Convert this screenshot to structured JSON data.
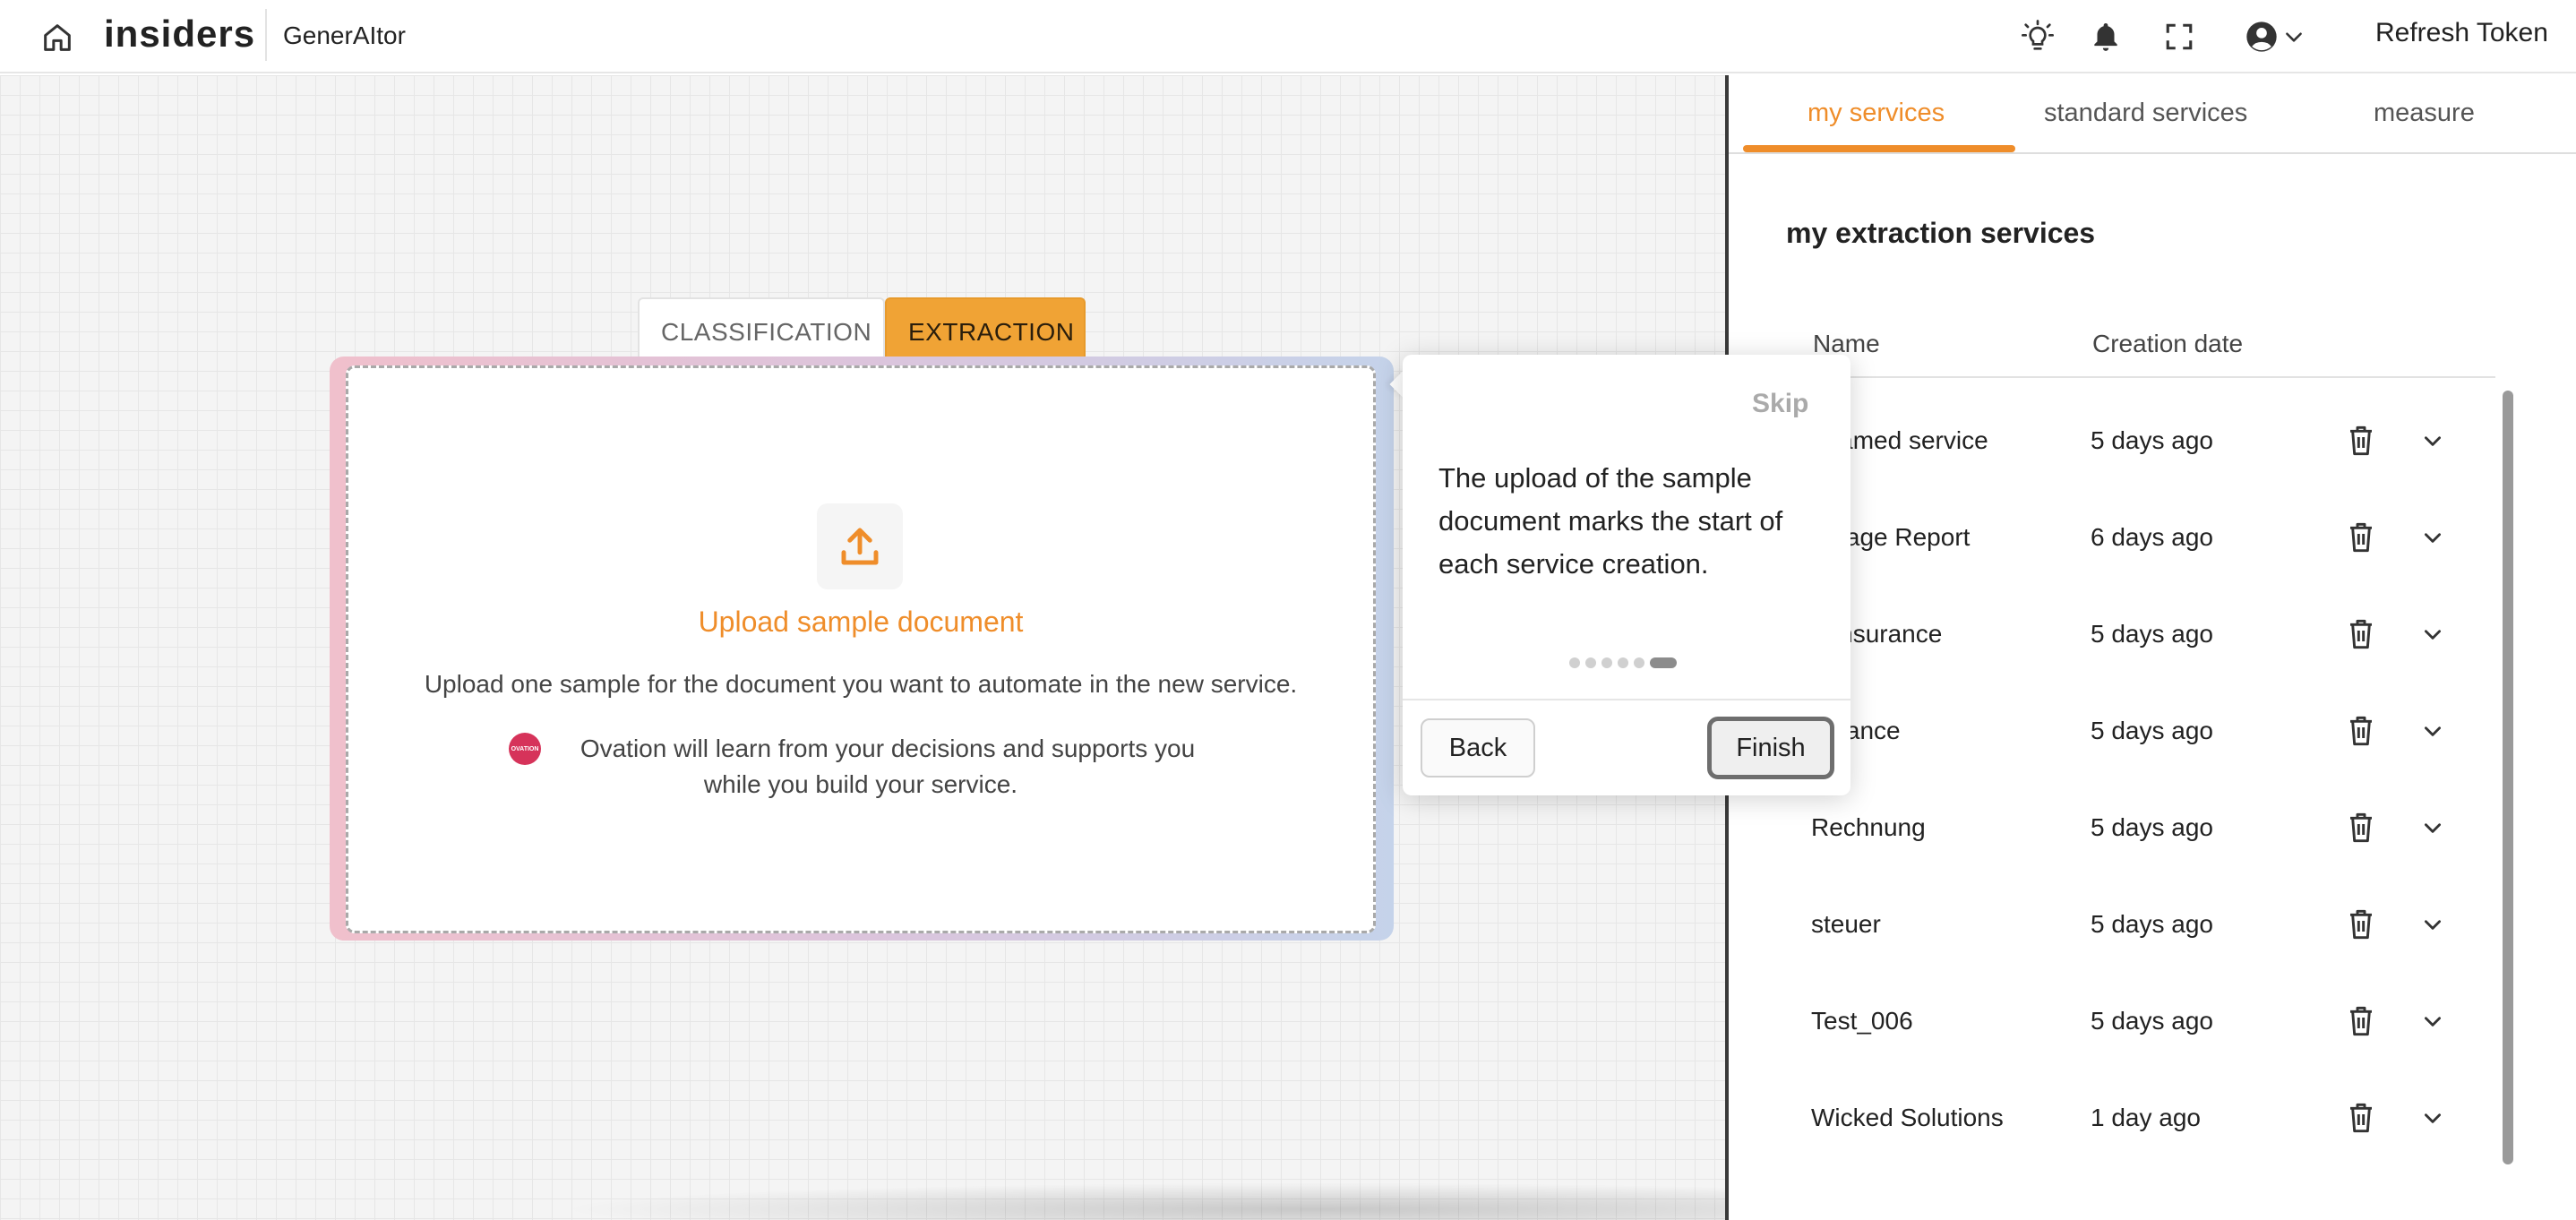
{
  "header": {
    "brand": "insiders",
    "app_name": "GenerAItor",
    "refresh_label": "Refresh Token",
    "icons": [
      "home-icon",
      "lightbulb-icon",
      "bell-icon",
      "fullscreen-icon",
      "user-circle-icon",
      "chevron-down-icon"
    ]
  },
  "mode_tabs": {
    "classification": "CLASSIFICATION",
    "extraction": "EXTRACTION",
    "active": "EXTRACTION"
  },
  "upload": {
    "title": "Upload sample document",
    "description": "Upload one sample for the document you want to automate in the new service.",
    "ovation_line1": "Ovation will learn from your decisions and supports you",
    "ovation_line2": "while you build your service.",
    "logo_text": "OVATION"
  },
  "tour": {
    "skip_label": "Skip",
    "text": "The upload of the sample document marks the start of each service creation.",
    "back_label": "Back",
    "finish_label": "Finish",
    "step_current": 6,
    "step_total": 6
  },
  "panel": {
    "tabs": [
      "my services",
      "standard services",
      "measure"
    ],
    "active_tab": "my services",
    "title": "my extraction services",
    "columns": {
      "name": "Name",
      "date": "Creation date"
    },
    "rows": [
      {
        "name": "nnamed service",
        "date": "5 days ago"
      },
      {
        "name": "amage Report",
        "date": "6 days ago"
      },
      {
        "name": "o Insurance",
        "date": "5 days ago"
      },
      {
        "name": "surance",
        "date": "5 days ago"
      },
      {
        "name": "Rechnung",
        "date": "5 days ago"
      },
      {
        "name": "steuer",
        "date": "5 days ago"
      },
      {
        "name": "Test_006",
        "date": "5 days ago"
      },
      {
        "name": "Wicked Solutions",
        "date": "1 day ago"
      }
    ]
  },
  "colors": {
    "accent": "#ef8d2a",
    "tab_active_bg": "#f0a335",
    "panel_border": "#3a3a3a"
  }
}
